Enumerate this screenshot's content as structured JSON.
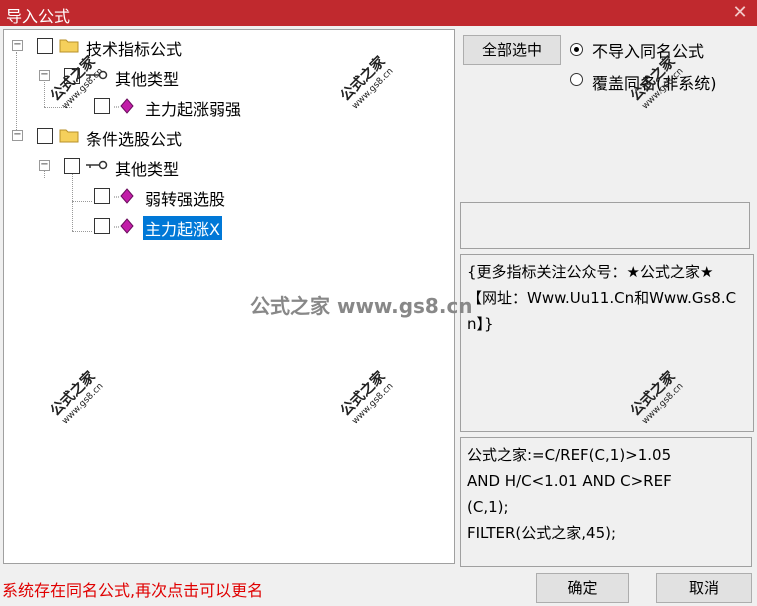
{
  "window": {
    "title": "导入公式",
    "close_glyph": "✕"
  },
  "tree": {
    "nodes": [
      {
        "label": "技术指标公式"
      },
      {
        "label": "其他类型"
      },
      {
        "label": "主力起涨弱强"
      },
      {
        "label": "条件选股公式"
      },
      {
        "label": "其他类型"
      },
      {
        "label": "弱转强选股"
      },
      {
        "label": "主力起涨X"
      }
    ],
    "expander_glyph": "−"
  },
  "controls": {
    "select_all_label": "全部选中",
    "radio_options": [
      {
        "label": "不导入同名公式",
        "selected": true
      },
      {
        "label": "覆盖同名(非系统)",
        "selected": false
      }
    ]
  },
  "description": {
    "text": "{更多指标关注公众号：★公式之家★ 【网址：Www.Uu11.Cn和Www.Gs8.Cn】}"
  },
  "formula": {
    "lines": [
      "公式之家:=C/REF(C,1)>1.05",
      "AND H/C<1.01 AND C>REF",
      "(C,1);",
      "FILTER(公式之家,45);"
    ]
  },
  "footer": {
    "status_text": "系统存在同名公式,再次点击可以更名",
    "ok_label": "确定",
    "cancel_label": "取消"
  },
  "watermark": {
    "center_text": "公式之家 www.gs8.cn",
    "stamp_text": "公式之家",
    "stamp_url": "www.gs8.cn"
  },
  "colors": {
    "titlebar": "#c0292e",
    "selection": "#0078d7",
    "status": "#e00000"
  }
}
